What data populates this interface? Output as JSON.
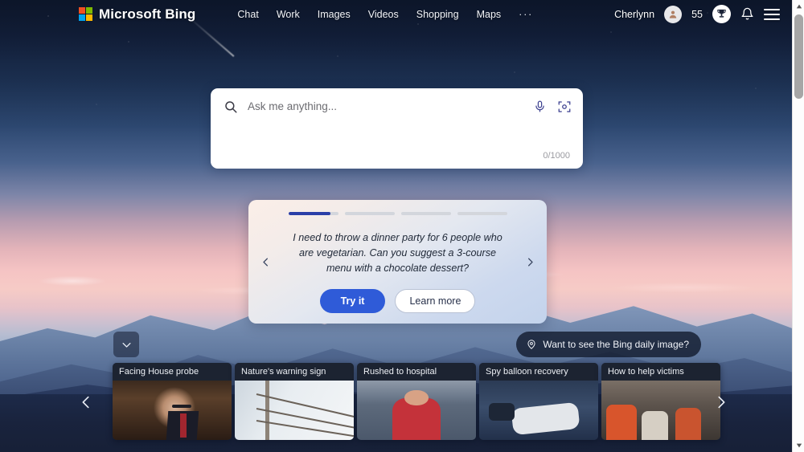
{
  "header": {
    "logo_text": "Microsoft Bing",
    "logo_colors": [
      "#f25022",
      "#7fba00",
      "#00a4ef",
      "#ffb900"
    ],
    "nav": [
      {
        "label": "Chat",
        "name": "nav-chat"
      },
      {
        "label": "Work",
        "name": "nav-work"
      },
      {
        "label": "Images",
        "name": "nav-images"
      },
      {
        "label": "Videos",
        "name": "nav-videos"
      },
      {
        "label": "Shopping",
        "name": "nav-shopping"
      },
      {
        "label": "Maps",
        "name": "nav-maps"
      }
    ],
    "more_label": "···",
    "user_name": "Cherlynn",
    "rewards_points": "55",
    "icons": {
      "avatar": "person-icon",
      "rewards": "trophy-icon",
      "notifications": "bell-icon",
      "menu": "hamburger-icon"
    }
  },
  "search": {
    "placeholder": "Ask me anything...",
    "value": "",
    "counter": "0/1000",
    "icons": {
      "search": "search-icon",
      "mic": "microphone-icon",
      "visual": "visual-search-icon"
    }
  },
  "suggestion": {
    "bars": [
      85,
      0,
      0,
      0
    ],
    "prompt": "I need to throw a dinner party for 6 people who are vegetarian. Can you suggest a 3-course menu with a chocolate dessert?",
    "try_label": "Try it",
    "learn_label": "Learn more",
    "prev_icon": "chevron-left-icon",
    "next_icon": "chevron-right-icon",
    "accent_color": "#2f5bd8",
    "bar_fill_color": "#2b3fa8"
  },
  "midrow": {
    "collapse_icon": "chevron-down-icon",
    "daily_image_label": "Want to see the Bing daily image?",
    "daily_image_icon": "location-pin-icon"
  },
  "news": {
    "prev_icon": "chevron-left-icon",
    "next_icon": "chevron-right-icon",
    "cards": [
      {
        "title": "Facing House probe"
      },
      {
        "title": "Nature's warning sign"
      },
      {
        "title": "Rushed to hospital"
      },
      {
        "title": "Spy balloon recovery"
      },
      {
        "title": "How to help victims"
      }
    ]
  },
  "scrollbar": {
    "up_icon": "triangle-up-icon",
    "down_icon": "triangle-down-icon"
  }
}
